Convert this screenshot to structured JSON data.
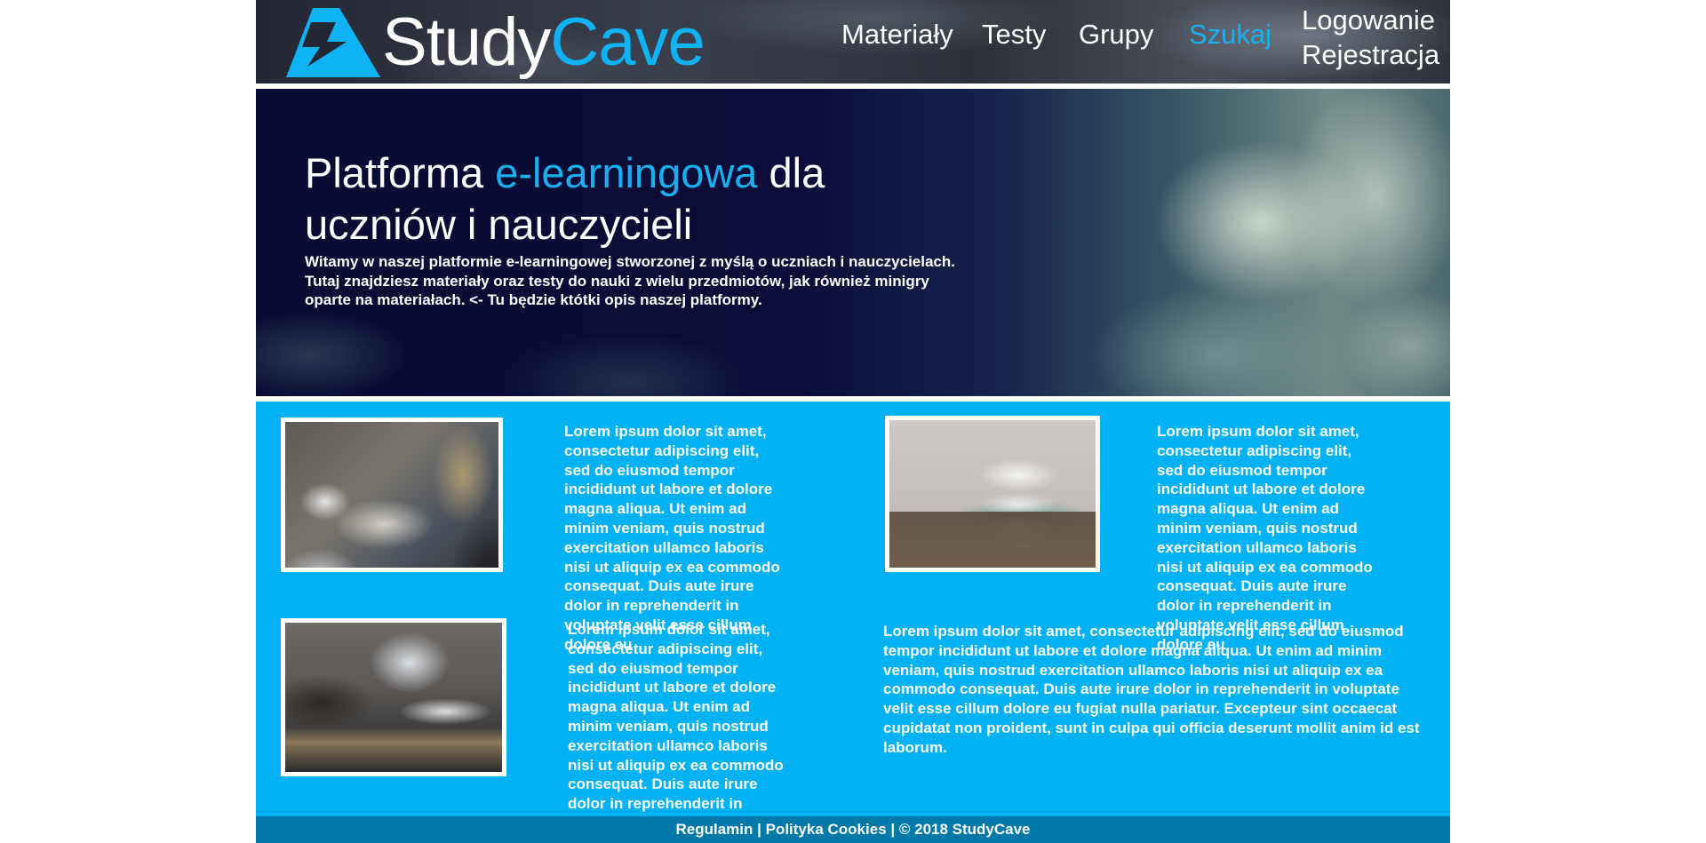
{
  "brand": {
    "name_part1": "Study",
    "name_part2": "Cave",
    "colors": {
      "accent": "#0fb2f3",
      "content_bg": "#00b2f3",
      "footer_bg": "#0078a8",
      "text": "#ffffff"
    }
  },
  "nav": {
    "items": [
      {
        "label": "Materiały",
        "active": false
      },
      {
        "label": "Testy",
        "active": false
      },
      {
        "label": "Grupy",
        "active": false
      },
      {
        "label": "Szukaj",
        "active": true
      }
    ],
    "login_label": "Logowanie",
    "register_label": "Rejestracja"
  },
  "hero": {
    "title_part1": "Platforma ",
    "title_accent": "e-learningowa",
    "title_part2": " dla uczniów i nauczycieli",
    "description": "Witamy w naszej platformie e-learningowej stworzonej z myślą o uczniach i nauczycielach. Tutaj znajdziesz materiały oraz testy do nauki z wielu przedmiotów, jak również minigry oparte na materiałach. <- Tu będzie któtki opis naszej platformy."
  },
  "cards": [
    {
      "image_icon": "photo-students-meeting",
      "text": "Lorem ipsum dolor sit amet, consectetur adipiscing elit, sed do eiusmod tempor incididunt ut labore et dolore magna aliqua. Ut enim ad minim veniam, quis nostrud exercitation ullamco laboris nisi ut aliquip ex ea commodo consequat. Duis aute irure dolor in reprehenderit in voluptate velit esse cillum dolore eu"
    },
    {
      "image_icon": "photo-books-stack",
      "text": "Lorem ipsum dolor sit amet, consectetur adipiscing elit, sed do eiusmod tempor incididunt ut labore et dolore magna aliqua. Ut enim ad minim veniam, quis nostrud exercitation ullamco laboris nisi ut aliquip ex ea commodo consequat. Duis aute irure dolor in reprehenderit in voluptate velit esse cillum dolore eu"
    },
    {
      "image_icon": "photo-laptop-desk",
      "text": "Lorem ipsum dolor sit amet, consectetur adipiscing elit, sed do eiusmod tempor incididunt ut labore et dolore magna aliqua. Ut enim ad minim veniam, quis nostrud exercitation ullamco laboris nisi ut aliquip ex ea commodo consequat. Duis aute irure dolor in reprehenderit in voluptate velit esse cillum dolore eu"
    }
  ],
  "wide_text": "Lorem ipsum dolor sit amet, consectetur adipiscing elit, sed do eiusmod tempor incididunt ut labore et dolore magna aliqua. Ut enim ad minim veniam, quis nostrud exercitation ullamco laboris nisi ut aliquip ex ea commodo consequat. Duis aute irure dolor in reprehenderit in voluptate velit esse cillum dolore eu fugiat nulla pariatur. Excepteur sint occaecat cupidatat non proident, sunt in culpa qui officia deserunt mollit anim id est laborum.",
  "footer": {
    "regulamin": "Regulamin",
    "separator": " | ",
    "cookies": "Polityka Cookies",
    "copyright": "© 2018 StudyCave"
  }
}
